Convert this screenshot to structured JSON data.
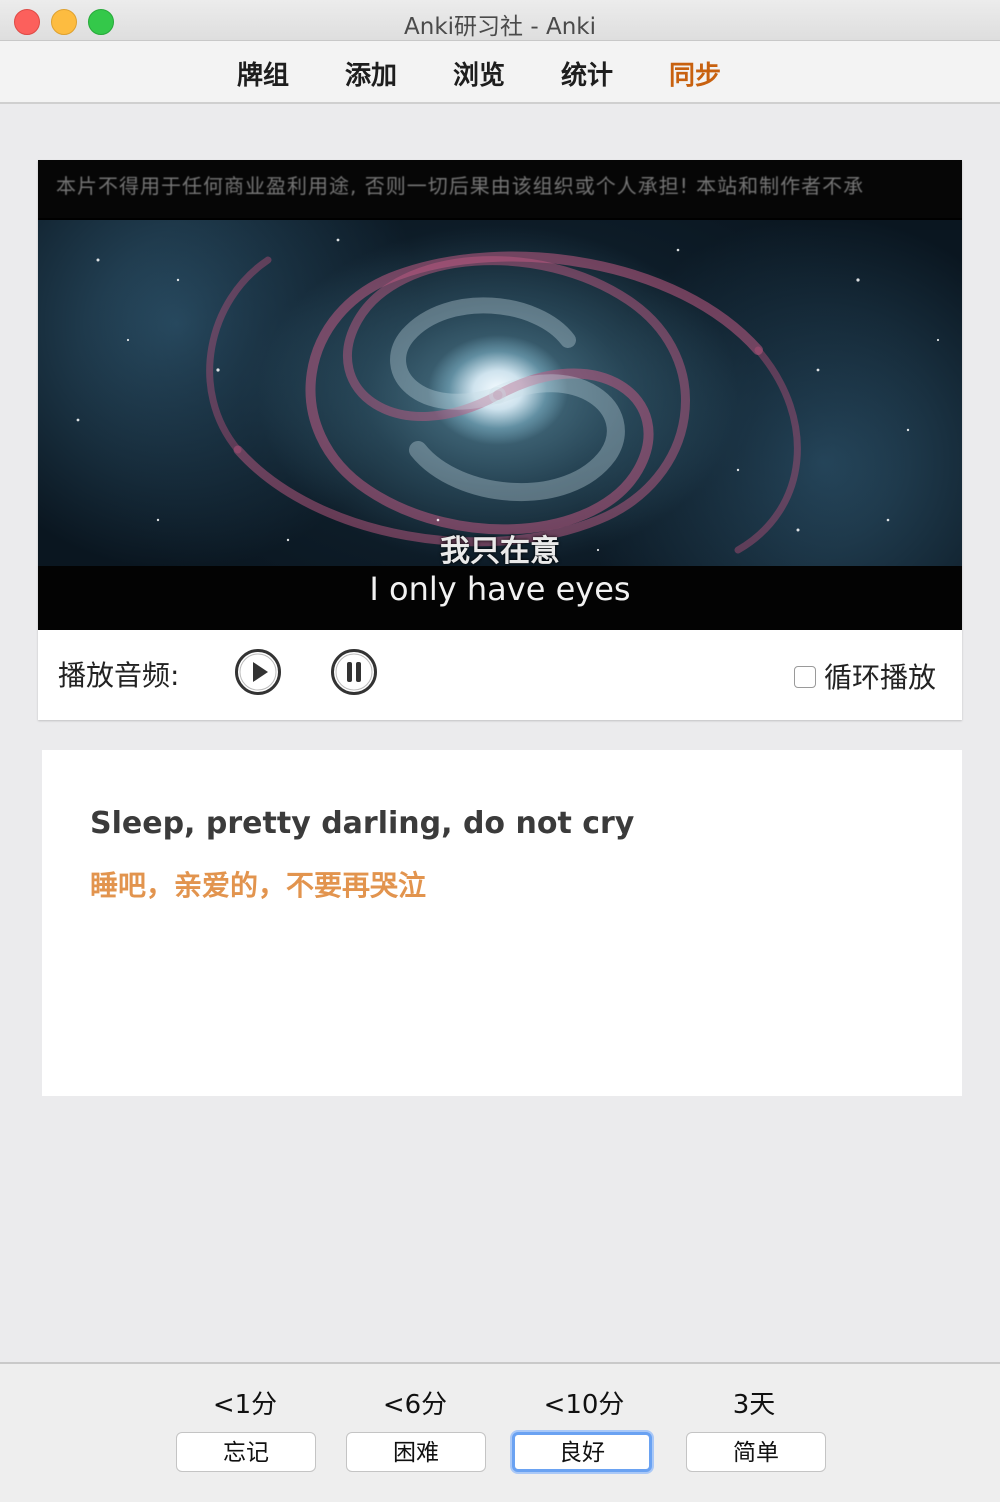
{
  "window": {
    "title": "Anki研习社 - Anki"
  },
  "toolbar": {
    "items": [
      {
        "label": "牌组"
      },
      {
        "label": "添加"
      },
      {
        "label": "浏览"
      },
      {
        "label": "统计"
      },
      {
        "label": "同步",
        "accent": "#c8610f"
      }
    ]
  },
  "video": {
    "watermark": "本片不得用于任何商业盈利用途, 否则一切后果由该组织或个人承担!   本站和制作者不承",
    "subtitle_cn": "我只在意",
    "subtitle_en": "I only have eyes"
  },
  "audio": {
    "label": "播放音频:",
    "play_icon": "play-icon",
    "pause_icon": "pause-icon",
    "loop_label": "循环播放",
    "loop_checked": false
  },
  "card": {
    "english": "Sleep, pretty darling, do not cry",
    "chinese": "睡吧，亲爱的，不要再哭泣",
    "chinese_color": "#e2944e"
  },
  "answers": [
    {
      "interval": "<1分",
      "label": "忘记"
    },
    {
      "interval": "<6分",
      "label": "困难"
    },
    {
      "interval": "<10分",
      "label": "良好",
      "focused": true
    },
    {
      "interval": "3天",
      "label": "简单"
    }
  ],
  "colors": {
    "focus_ring": "#6aa2f2",
    "background": "#ebebed"
  }
}
